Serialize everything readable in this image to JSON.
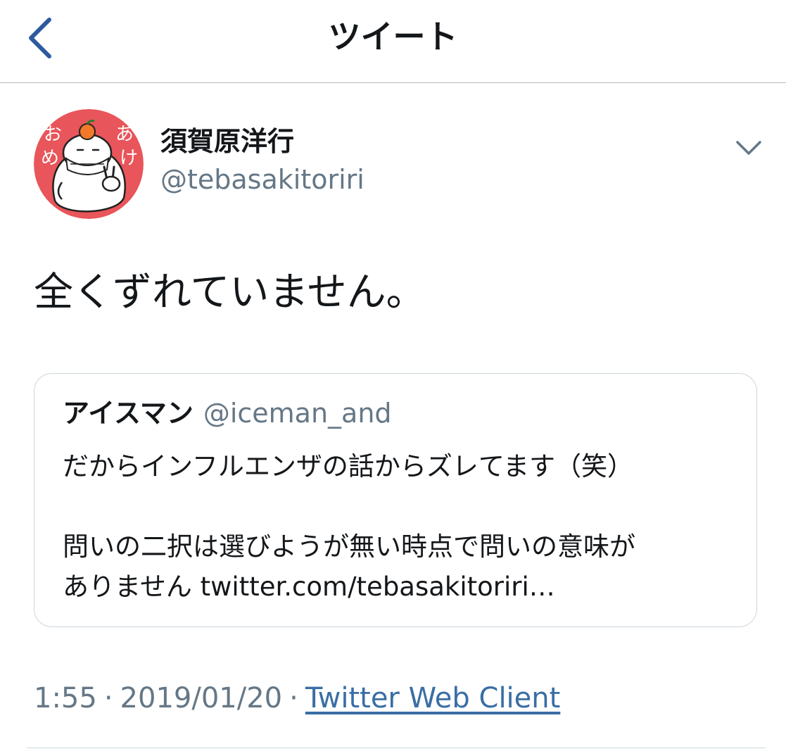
{
  "navbar": {
    "title": "ツイート",
    "back_icon": "chevron-left-icon"
  },
  "tweet": {
    "author": {
      "display_name": "須賀原洋行",
      "handle": "@tebasakitoriri",
      "avatar_text": [
        "お",
        "め",
        "あ",
        "け"
      ]
    },
    "menu_icon": "chevron-down-icon",
    "text": "全くずれていません。",
    "quote": {
      "name": "アイスマン",
      "handle": "@iceman_and",
      "lines": [
        "だからインフルエンザの話からズレてます（笑）",
        "",
        "問いの二択は選びようが無い時点で問いの意味が",
        "ありません twitter.com/tebasakitoriri…"
      ]
    },
    "meta": {
      "time": "1:55",
      "separator": "·",
      "date": "2019/01/20",
      "source": "Twitter Web Client"
    }
  },
  "colors": {
    "accent": "#2d5a9e",
    "link": "#3a6ea5",
    "secondary_text": "#657786",
    "avatar_bg": "#e8555a"
  }
}
